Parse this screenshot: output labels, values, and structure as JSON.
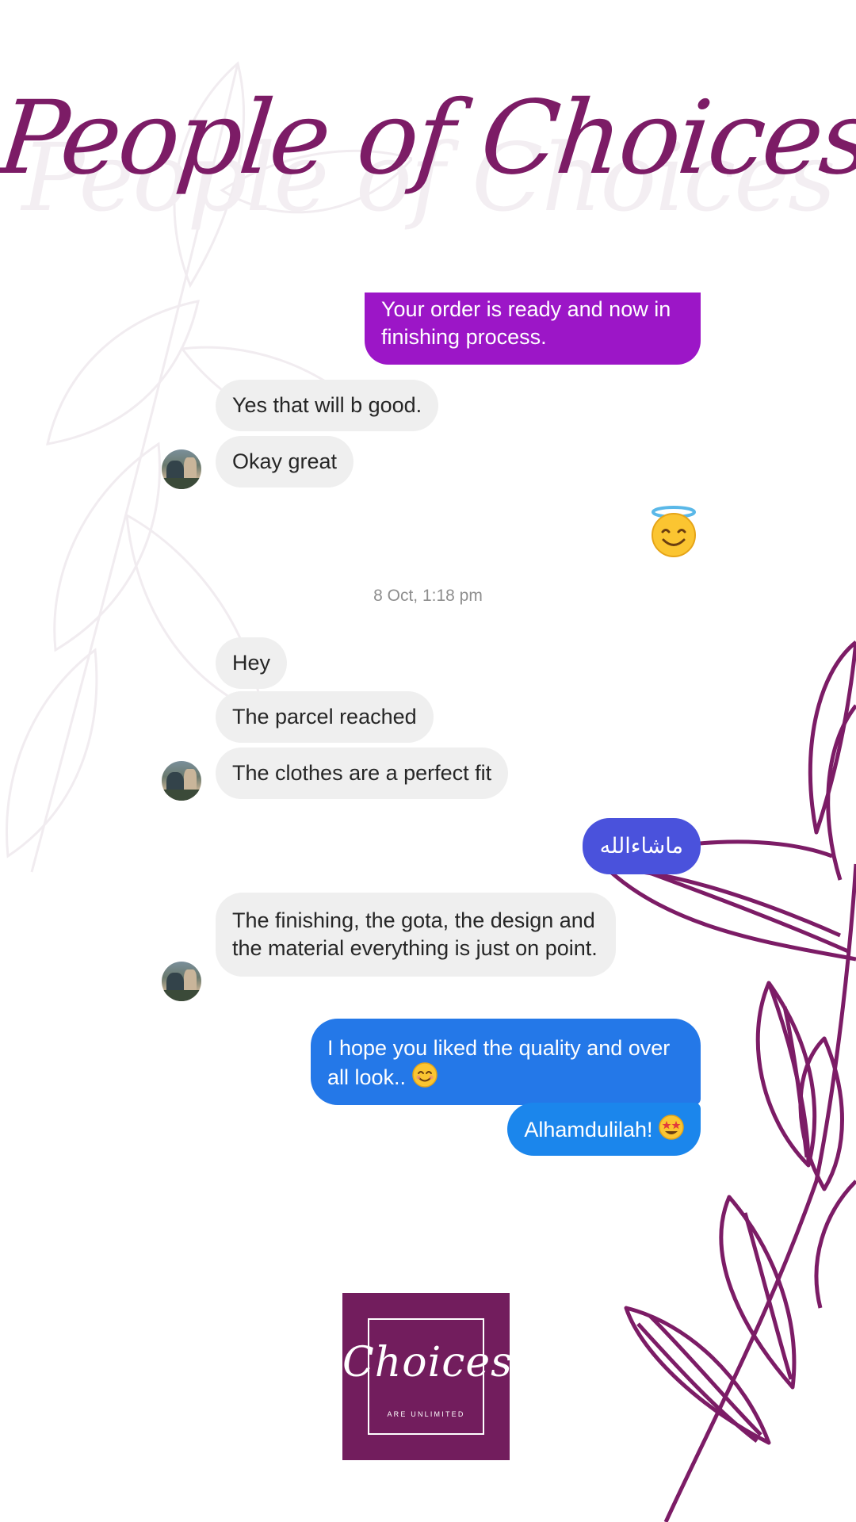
{
  "header": {
    "title": "People of Choices"
  },
  "colors": {
    "brand": "#7c1c66",
    "incoming_bubble": "#efefef",
    "outgoing_purple": "#9c16c7",
    "outgoing_indigo": "#4a52dc",
    "outgoing_blue": "#2478e8",
    "logo_bg": "#721d5d"
  },
  "messages": [
    {
      "direction": "outgoing",
      "text": "Your order is ready and now in finishing process."
    },
    {
      "direction": "incoming",
      "text": "Yes that will b good."
    },
    {
      "direction": "incoming",
      "text": "Okay great"
    },
    {
      "direction": "outgoing",
      "emoji": "smiling-face-with-halo"
    },
    {
      "direction": "incoming",
      "text": "Hey"
    },
    {
      "direction": "incoming",
      "text": "The parcel reached"
    },
    {
      "direction": "incoming",
      "text": "The clothes are a perfect fit"
    },
    {
      "direction": "outgoing",
      "text": "ماشاءالله"
    },
    {
      "direction": "incoming",
      "text": "The finishing, the gota, the design and the material everything is just on point."
    },
    {
      "direction": "outgoing",
      "text": "I hope you liked the quality and over all look..",
      "emoji": "smiling-face-with-smiling-eyes"
    },
    {
      "direction": "outgoing",
      "text": "Alhamdulilah!",
      "emoji": "star-struck"
    }
  ],
  "timestamp": "8 Oct, 1:18 pm",
  "logo": {
    "word": "Choices",
    "tagline": "ARE UNLIMITED"
  }
}
